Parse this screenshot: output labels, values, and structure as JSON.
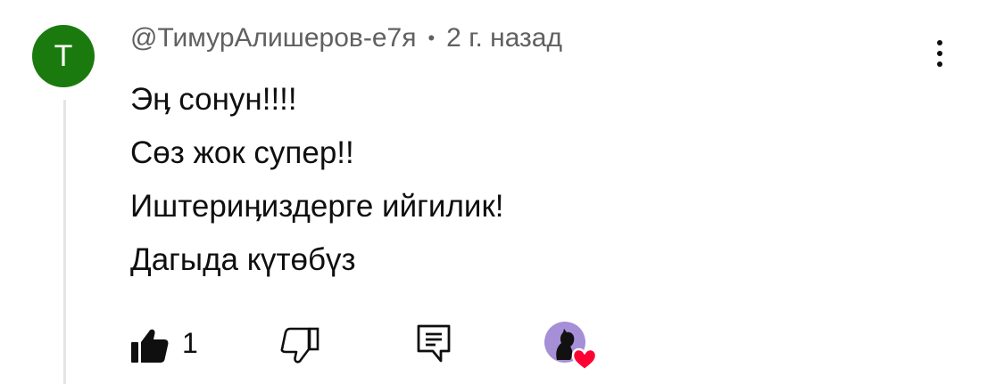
{
  "comment": {
    "avatar_letter": "T",
    "avatar_color": "#1b7a0e",
    "author": "@ТимурАлишеров-е7я",
    "separator": "•",
    "time": "2 г. назад",
    "lines": [
      "Эӊ сонун!!!!",
      "Сөз жок супер!!",
      "Иштериӊиздерге ийгилик!",
      "Дагыда күтөбүз"
    ],
    "like_count": "1"
  },
  "icons": {
    "more": "more-vert-icon",
    "like": "thumbs-up-filled-icon",
    "dislike": "thumbs-down-icon",
    "reply": "reply-comment-icon",
    "creator_heart": "creator-heart-icon"
  },
  "colors": {
    "heart": "#ff0033",
    "creator_avatar": "#a58fd6",
    "meta_text": "#606060"
  }
}
